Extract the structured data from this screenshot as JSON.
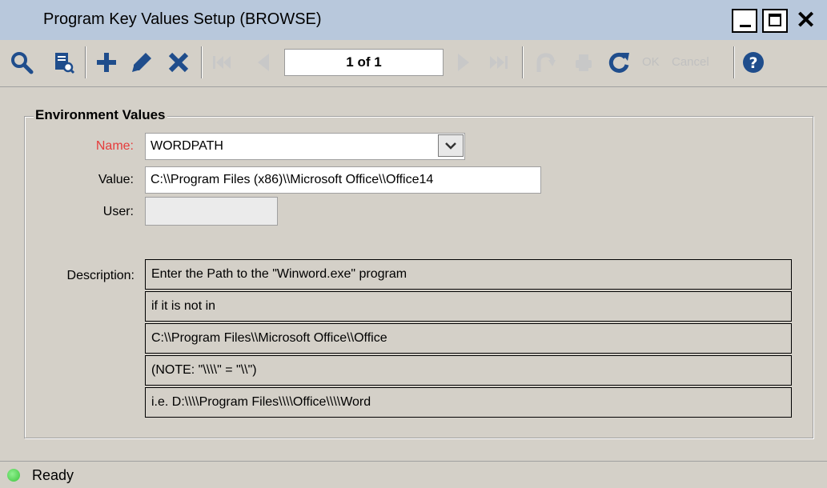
{
  "window": {
    "title": "Program Key Values Setup (BROWSE)"
  },
  "toolbar": {
    "record_indicator": "1 of 1",
    "ok_label": "OK",
    "cancel_label": "Cancel",
    "icons": [
      "search-icon",
      "report-icon",
      "add-icon",
      "edit-icon",
      "delete-icon",
      "first-record-icon",
      "previous-record-icon",
      "next-record-icon",
      "last-record-icon",
      "undo-icon",
      "print-icon",
      "refresh-icon",
      "help-icon"
    ]
  },
  "group": {
    "title": "Environment Values",
    "name_label": "Name:",
    "name_value": "WORDPATH",
    "value_label": "Value:",
    "value_value": "C:\\\\Program Files (x86)\\\\Microsoft Office\\\\Office14",
    "user_label": "User:",
    "user_value": "",
    "description_label": "Description:",
    "description_lines": [
      "Enter the Path to the \"Winword.exe\" program",
      "if it is not in",
      "C:\\\\Program Files\\\\Microsoft Office\\\\Office",
      "(NOTE: \"\\\\\\\\\" = \"\\\\\")",
      "i.e. D:\\\\\\\\Program Files\\\\\\\\Office\\\\\\\\Word"
    ]
  },
  "status": {
    "text": "Ready",
    "indicator_color": "#4cd44c"
  },
  "colors": {
    "title_bar": "#b8c8dc",
    "toolbar_icon_blue": "#1f4d8c",
    "required_label_red": "#e63b3b"
  }
}
